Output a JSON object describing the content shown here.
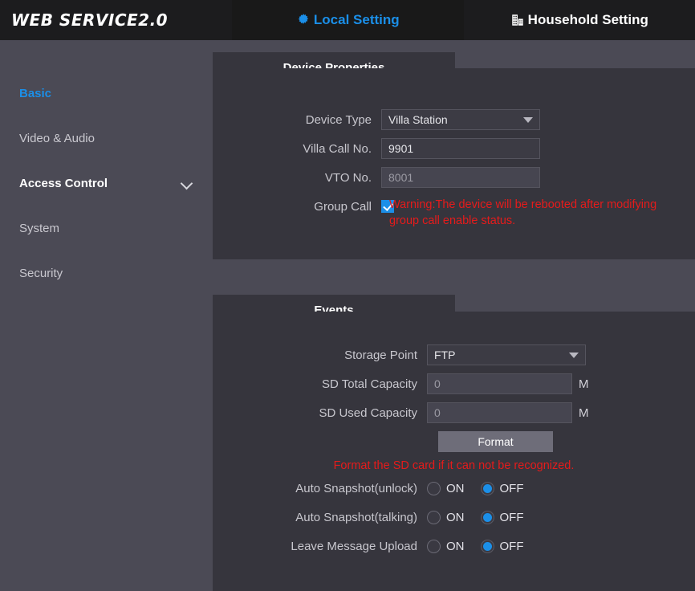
{
  "header": {
    "brand": "WEB SERVICE2.0",
    "tabs": [
      {
        "label": "Local Setting",
        "icon": "gear-icon",
        "active": true
      },
      {
        "label": "Household Setting",
        "icon": "building-icon",
        "active": false
      }
    ],
    "accent_color": "#1b8fe8"
  },
  "sidebar": {
    "items": [
      {
        "label": "Basic",
        "active": true,
        "expandable": false
      },
      {
        "label": "Video & Audio",
        "active": false,
        "expandable": false
      },
      {
        "label": "Access Control",
        "active": false,
        "expandable": true
      },
      {
        "label": "System",
        "active": false,
        "expandable": false
      },
      {
        "label": "Security",
        "active": false,
        "expandable": false
      }
    ]
  },
  "device_properties": {
    "tab_title": "Device Properties",
    "device_type": {
      "label": "Device Type",
      "value": "Villa Station"
    },
    "villa_call_no": {
      "label": "Villa Call No.",
      "value": "9901"
    },
    "vto_no": {
      "label": "VTO No.",
      "value": "8001",
      "disabled": true
    },
    "group_call": {
      "label": "Group Call",
      "checked": true
    },
    "warning": "Warning:The device will be rebooted after modifying group call enable status.",
    "warning_color": "#e51b1b"
  },
  "events": {
    "tab_title": "Events",
    "storage_point": {
      "label": "Storage Point",
      "value": "FTP"
    },
    "sd_total_capacity": {
      "label": "SD Total Capacity",
      "value": "0",
      "unit": "M"
    },
    "sd_used_capacity": {
      "label": "SD Used Capacity",
      "value": "0",
      "unit": "M"
    },
    "format_button": "Format",
    "format_hint": "Format the SD card if it can not be recognized.",
    "toggles": [
      {
        "label": "Auto Snapshot(unlock)",
        "on_label": "ON",
        "off_label": "OFF",
        "selected": "OFF"
      },
      {
        "label": "Auto Snapshot(talking)",
        "on_label": "ON",
        "off_label": "OFF",
        "selected": "OFF"
      },
      {
        "label": "Leave Message Upload",
        "on_label": "ON",
        "off_label": "OFF",
        "selected": "OFF"
      }
    ]
  }
}
